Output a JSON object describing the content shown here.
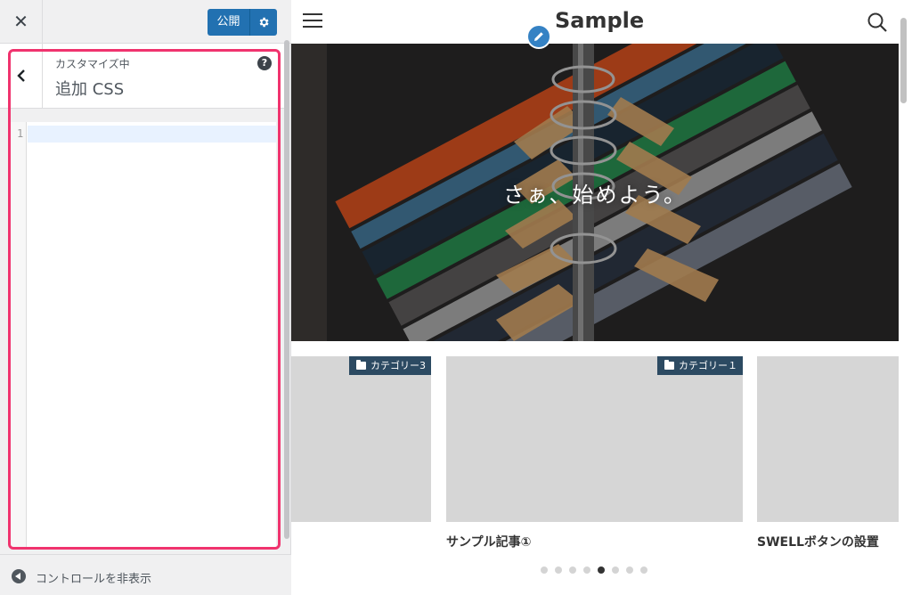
{
  "sidebar": {
    "close_glyph": "✕",
    "publish_label": "公開",
    "section_pre": "カスタマイズ中",
    "section_title": "追加 CSS",
    "help_glyph": "?",
    "editor": {
      "line_number": "1",
      "content": ""
    },
    "footer_label": "コントロールを非表示"
  },
  "preview": {
    "site_title": "Sample",
    "hero_text": "さぁ、始めよう。",
    "cards": [
      {
        "category": "カテゴリー3",
        "title": ""
      },
      {
        "category": "カテゴリー１",
        "title": "サンプル記事①"
      },
      {
        "category": "",
        "title": "SWELLボタンの設置"
      }
    ],
    "pagination": {
      "total": 8,
      "active": 5
    }
  },
  "colors": {
    "publish": "#2271b1",
    "highlight": "#f0336e",
    "category_badge": "#2c4a62",
    "edit_shortcut": "#3582c4"
  },
  "icons": [
    "close-icon",
    "gear-icon",
    "chevron-left-icon",
    "help-icon",
    "collapse-icon",
    "menu-icon",
    "pencil-icon",
    "search-icon",
    "folder-icon"
  ]
}
